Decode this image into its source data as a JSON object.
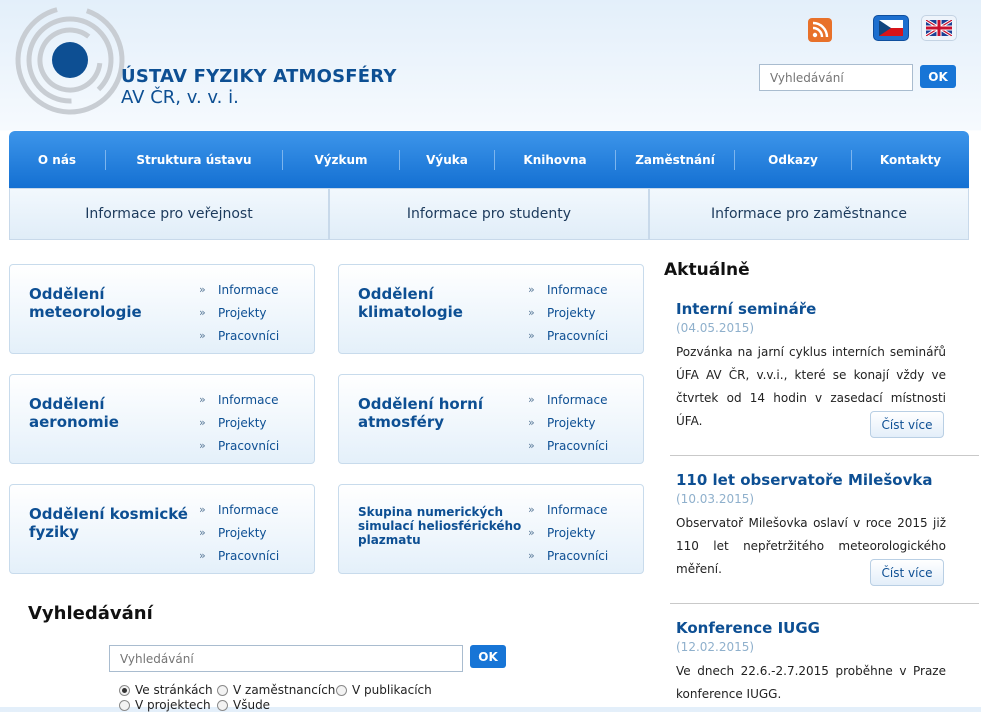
{
  "header": {
    "brand_name": "ÚSTAV FYZIKY ATMOSFÉRY",
    "brand_sub": "AV ČR, v. v. i.",
    "search_placeholder": "Vyhledávání",
    "ok_label": "OK",
    "icons": {
      "rss": "rss-icon",
      "cz": "czech-flag-icon",
      "en": "uk-flag-icon"
    },
    "colors": {
      "brand": "#0d4f93",
      "nav": "#1470d2",
      "rss": "#e8712a"
    }
  },
  "nav": {
    "items": [
      "O nás",
      "Struktura ústavu",
      "Výzkum",
      "Výuka",
      "Knihovna",
      "Zaměstnání",
      "Odkazy",
      "Kontakty"
    ]
  },
  "tabs": [
    "Informace pro veřejnost",
    "Informace pro studenty",
    "Informace pro zaměstnance"
  ],
  "departments": [
    {
      "title": "Oddělení meteorologie",
      "links": [
        "Informace",
        "Projekty",
        "Pracovníci"
      ]
    },
    {
      "title": "Oddělení klimatologie",
      "links": [
        "Informace",
        "Projekty",
        "Pracovníci"
      ]
    },
    {
      "title": "Oddělení aeronomie",
      "links": [
        "Informace",
        "Projekty",
        "Pracovníci"
      ]
    },
    {
      "title": "Oddělení horní atmosféry",
      "links": [
        "Informace",
        "Projekty",
        "Pracovníci"
      ]
    },
    {
      "title": "Oddělení kosmické fyziky",
      "links": [
        "Informace",
        "Projekty",
        "Pracovníci"
      ]
    },
    {
      "title": "Skupina numerických simulací heliosférického plazmatu",
      "links": [
        "Informace",
        "Projekty",
        "Pracovníci"
      ]
    }
  ],
  "link_bullet": "»",
  "search": {
    "heading": "Vyhledávání",
    "placeholder": "Vyhledávání",
    "ok_label": "OK",
    "options": [
      {
        "label": "Ve stránkách",
        "checked": true
      },
      {
        "label": "V zaměstnancích",
        "checked": false
      },
      {
        "label": "V publikacích",
        "checked": false
      },
      {
        "label": "V projektech",
        "checked": false
      },
      {
        "label": "Všude",
        "checked": false
      }
    ]
  },
  "news": {
    "heading": "Aktuálně",
    "more_label": "Číst více",
    "items": [
      {
        "title": "Interní semináře",
        "date": "(04.05.2015)",
        "text": "Pozvánka na jarní cyklus interních seminářů ÚFA AV ČR, v.v.i., které se konají vždy ve čtvrtek od 14 hodin v zasedací místnosti ÚFA."
      },
      {
        "title": "110 let observatoře Milešovka",
        "date": "(10.03.2015)",
        "text": "Observatoř Milešovka oslaví v roce 2015 již 110 let nepřetržitého meteorologického měření."
      },
      {
        "title": "Konference IUGG",
        "date": "(12.02.2015)",
        "text": "Ve dnech 22.6.-2.7.2015 proběhne v Praze konference IUGG."
      }
    ]
  }
}
